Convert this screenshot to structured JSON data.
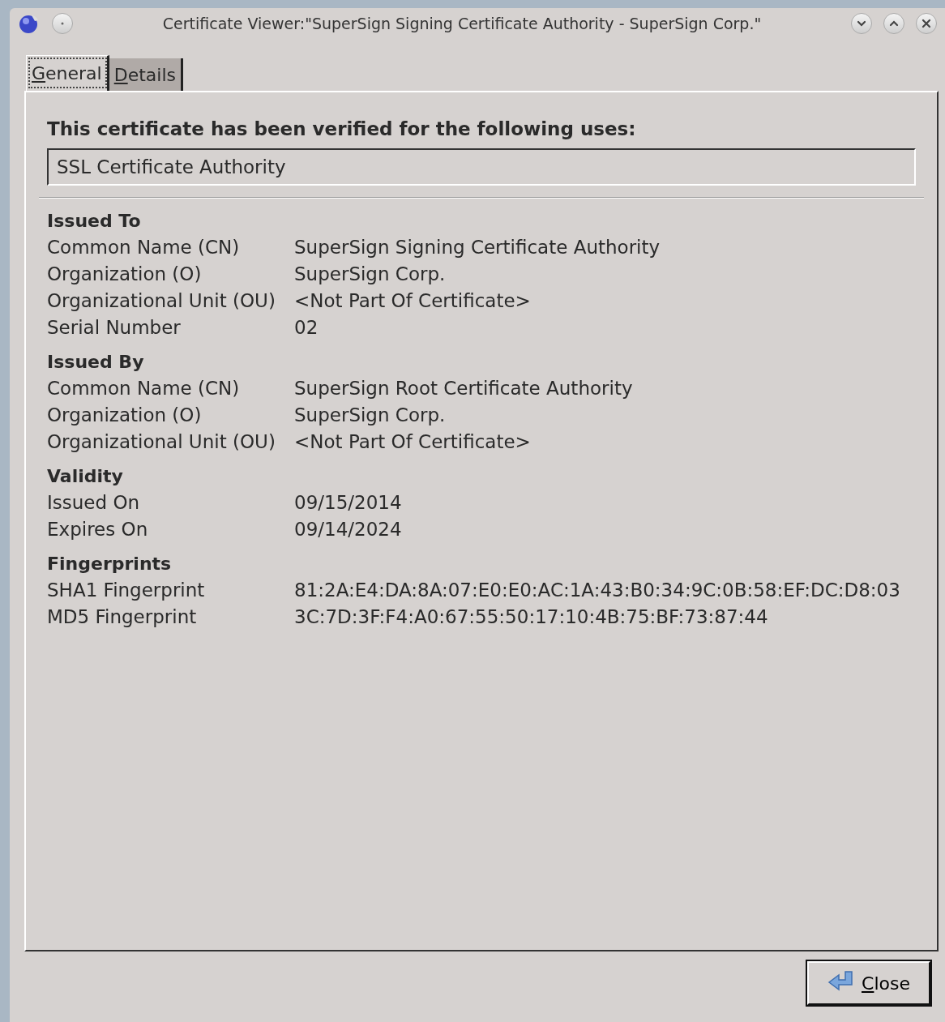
{
  "window": {
    "title": "Certificate Viewer:\"SuperSign Signing Certificate Authority - SuperSign Corp.\""
  },
  "tabs": [
    {
      "label": "General",
      "selected": true
    },
    {
      "label": "Details",
      "selected": false
    }
  ],
  "verified_heading": "This certificate has been verified for the following uses:",
  "uses_field": {
    "value": "SSL Certificate Authority"
  },
  "sections": [
    {
      "heading": "Issued To",
      "rows": [
        {
          "label": "Common Name (CN)",
          "value": "SuperSign Signing Certificate Authority"
        },
        {
          "label": "Organization (O)",
          "value": "SuperSign Corp."
        },
        {
          "label": "Organizational Unit (OU)",
          "value": "<Not Part Of Certificate>"
        },
        {
          "label": "Serial Number",
          "value": "02"
        }
      ]
    },
    {
      "heading": "Issued By",
      "rows": [
        {
          "label": "Common Name (CN)",
          "value": "SuperSign Root Certificate Authority"
        },
        {
          "label": "Organization (O)",
          "value": "SuperSign Corp."
        },
        {
          "label": "Organizational Unit (OU)",
          "value": "<Not Part Of Certificate>"
        }
      ]
    },
    {
      "heading": "Validity",
      "rows": [
        {
          "label": "Issued On",
          "value": "09/15/2014"
        },
        {
          "label": "Expires On",
          "value": "09/14/2024"
        }
      ]
    },
    {
      "heading": "Fingerprints",
      "rows": [
        {
          "label": "SHA1 Fingerprint",
          "value": "81:2A:E4:DA:8A:07:E0:E0:AC:1A:43:B0:34:9C:0B:58:EF:DC:D8:03"
        },
        {
          "label": "MD5 Fingerprint",
          "value": "3C:7D:3F:F4:A0:67:55:50:17:10:4B:75:BF:73:87:44"
        }
      ]
    }
  ],
  "close_button": {
    "label": "Close"
  }
}
